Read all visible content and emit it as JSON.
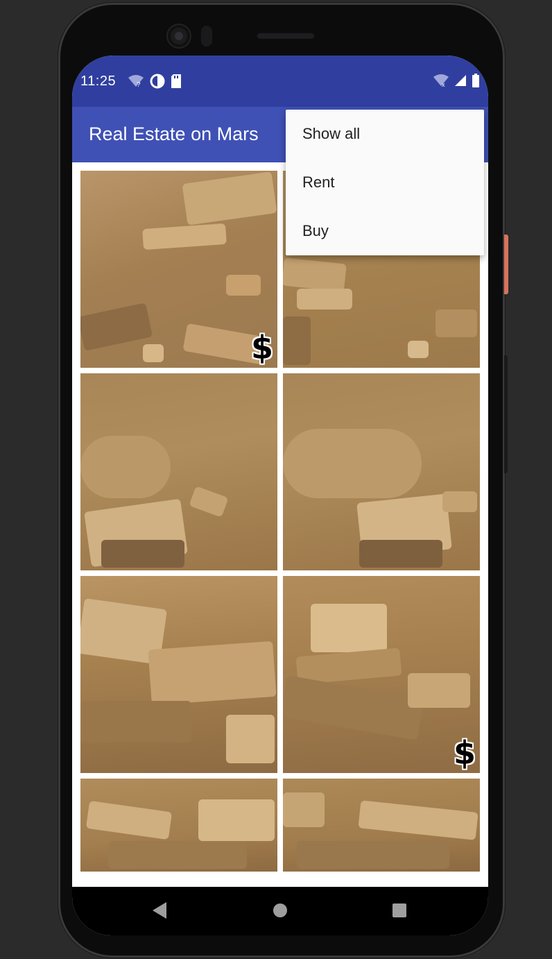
{
  "status_bar": {
    "time": "11:25",
    "left_icons": [
      "wifi-question-icon",
      "data-saver-icon",
      "sd-card-icon"
    ],
    "right_icons": [
      "wifi-off-icon",
      "signal-icon",
      "battery-icon"
    ]
  },
  "app_bar": {
    "title": "Real Estate on Mars",
    "color": "#3f51b5",
    "status_color": "#303f9f"
  },
  "menu": {
    "items": [
      {
        "label": "Show all"
      },
      {
        "label": "Rent"
      },
      {
        "label": "Buy"
      }
    ]
  },
  "grid": {
    "tiles": [
      {
        "type": "buy",
        "badge": "$"
      },
      {
        "type": "rent",
        "badge": ""
      },
      {
        "type": "rent",
        "badge": ""
      },
      {
        "type": "rent",
        "badge": ""
      },
      {
        "type": "rent",
        "badge": ""
      },
      {
        "type": "buy",
        "badge": "$"
      },
      {
        "type": "rent",
        "badge": ""
      },
      {
        "type": "rent",
        "badge": ""
      }
    ]
  },
  "nav_bar": {
    "icons": [
      "back-icon",
      "home-icon",
      "recents-icon"
    ]
  }
}
